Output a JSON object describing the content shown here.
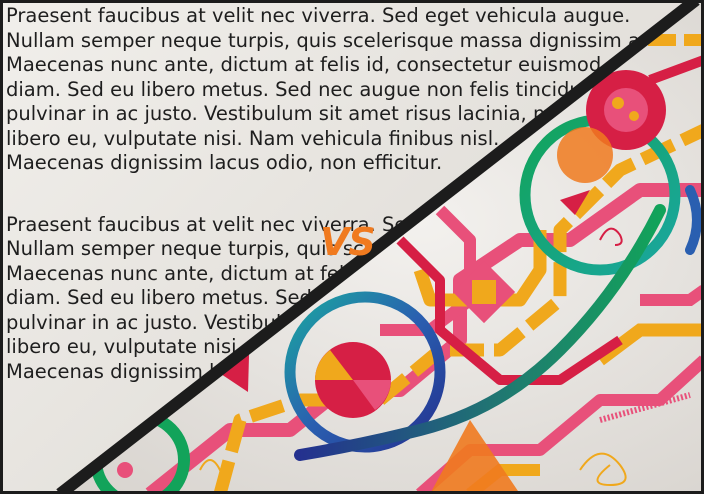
{
  "label": "VS",
  "text_lines": [
    "Praesent faucibus at velit nec viverra. Sed eget vehicula augue.",
    "Nullam semper neque turpis, quis scelerisque massa dignissim a.",
    "Maecenas nunc ante, dictum at felis id, consectetur euismod",
    "diam. Sed eu libero metus. Sed nec augue non felis tincidunt",
    "pulvinar in ac justo. Vestibulum sit amet risus lacinia, mollis",
    "libero eu, vulputate nisi. Nam vehicula finibus nisl.",
    "Maecenas dignissim lacus odio, non efficitur."
  ],
  "text_lines_2": [
    "Praesent faucibus at velit nec viverra. Sed eget vehicula augue.",
    "Nullam semper neque turpis, quis scelerisque massa dignissim a.",
    "Maecenas nunc ante, dictum at felis id, consectetur euismod",
    "diam. Sed eu libero metus. Sed nec augue non felis tincidunt",
    "pulvinar in ac justo. Vestibulum sit amet risus lacinia, mollis",
    "libero eu, vulputate nisi. Nam vehicula finibus nisl.",
    "Maecenas dignissim lacus odio, non efficitur."
  ],
  "colors": {
    "accent": "#f07a1f",
    "pink": "#e8507a",
    "crimson": "#d61f45",
    "gold": "#f0a81c",
    "green": "#12a35a",
    "teal": "#1aa7a0",
    "navy": "#24318f"
  }
}
